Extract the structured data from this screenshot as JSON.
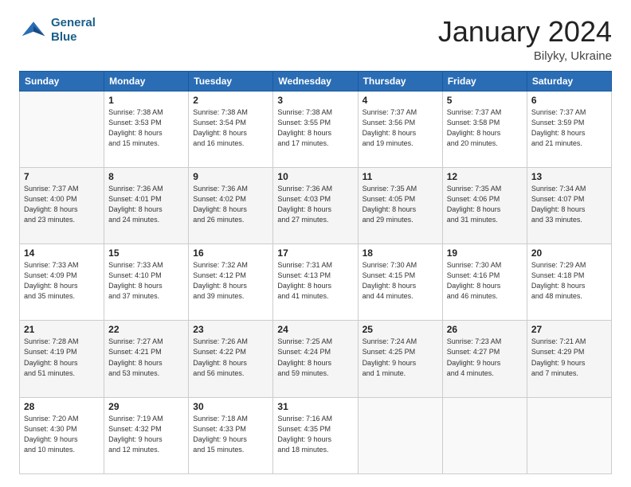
{
  "header": {
    "logo_line1": "General",
    "logo_line2": "Blue",
    "month": "January 2024",
    "location": "Bilyky, Ukraine"
  },
  "days_of_week": [
    "Sunday",
    "Monday",
    "Tuesday",
    "Wednesday",
    "Thursday",
    "Friday",
    "Saturday"
  ],
  "weeks": [
    [
      {
        "day": "",
        "info": ""
      },
      {
        "day": "1",
        "info": "Sunrise: 7:38 AM\nSunset: 3:53 PM\nDaylight: 8 hours\nand 15 minutes."
      },
      {
        "day": "2",
        "info": "Sunrise: 7:38 AM\nSunset: 3:54 PM\nDaylight: 8 hours\nand 16 minutes."
      },
      {
        "day": "3",
        "info": "Sunrise: 7:38 AM\nSunset: 3:55 PM\nDaylight: 8 hours\nand 17 minutes."
      },
      {
        "day": "4",
        "info": "Sunrise: 7:37 AM\nSunset: 3:56 PM\nDaylight: 8 hours\nand 19 minutes."
      },
      {
        "day": "5",
        "info": "Sunrise: 7:37 AM\nSunset: 3:58 PM\nDaylight: 8 hours\nand 20 minutes."
      },
      {
        "day": "6",
        "info": "Sunrise: 7:37 AM\nSunset: 3:59 PM\nDaylight: 8 hours\nand 21 minutes."
      }
    ],
    [
      {
        "day": "7",
        "info": "Sunrise: 7:37 AM\nSunset: 4:00 PM\nDaylight: 8 hours\nand 23 minutes."
      },
      {
        "day": "8",
        "info": "Sunrise: 7:36 AM\nSunset: 4:01 PM\nDaylight: 8 hours\nand 24 minutes."
      },
      {
        "day": "9",
        "info": "Sunrise: 7:36 AM\nSunset: 4:02 PM\nDaylight: 8 hours\nand 26 minutes."
      },
      {
        "day": "10",
        "info": "Sunrise: 7:36 AM\nSunset: 4:03 PM\nDaylight: 8 hours\nand 27 minutes."
      },
      {
        "day": "11",
        "info": "Sunrise: 7:35 AM\nSunset: 4:05 PM\nDaylight: 8 hours\nand 29 minutes."
      },
      {
        "day": "12",
        "info": "Sunrise: 7:35 AM\nSunset: 4:06 PM\nDaylight: 8 hours\nand 31 minutes."
      },
      {
        "day": "13",
        "info": "Sunrise: 7:34 AM\nSunset: 4:07 PM\nDaylight: 8 hours\nand 33 minutes."
      }
    ],
    [
      {
        "day": "14",
        "info": "Sunrise: 7:33 AM\nSunset: 4:09 PM\nDaylight: 8 hours\nand 35 minutes."
      },
      {
        "day": "15",
        "info": "Sunrise: 7:33 AM\nSunset: 4:10 PM\nDaylight: 8 hours\nand 37 minutes."
      },
      {
        "day": "16",
        "info": "Sunrise: 7:32 AM\nSunset: 4:12 PM\nDaylight: 8 hours\nand 39 minutes."
      },
      {
        "day": "17",
        "info": "Sunrise: 7:31 AM\nSunset: 4:13 PM\nDaylight: 8 hours\nand 41 minutes."
      },
      {
        "day": "18",
        "info": "Sunrise: 7:30 AM\nSunset: 4:15 PM\nDaylight: 8 hours\nand 44 minutes."
      },
      {
        "day": "19",
        "info": "Sunrise: 7:30 AM\nSunset: 4:16 PM\nDaylight: 8 hours\nand 46 minutes."
      },
      {
        "day": "20",
        "info": "Sunrise: 7:29 AM\nSunset: 4:18 PM\nDaylight: 8 hours\nand 48 minutes."
      }
    ],
    [
      {
        "day": "21",
        "info": "Sunrise: 7:28 AM\nSunset: 4:19 PM\nDaylight: 8 hours\nand 51 minutes."
      },
      {
        "day": "22",
        "info": "Sunrise: 7:27 AM\nSunset: 4:21 PM\nDaylight: 8 hours\nand 53 minutes."
      },
      {
        "day": "23",
        "info": "Sunrise: 7:26 AM\nSunset: 4:22 PM\nDaylight: 8 hours\nand 56 minutes."
      },
      {
        "day": "24",
        "info": "Sunrise: 7:25 AM\nSunset: 4:24 PM\nDaylight: 8 hours\nand 59 minutes."
      },
      {
        "day": "25",
        "info": "Sunrise: 7:24 AM\nSunset: 4:25 PM\nDaylight: 9 hours\nand 1 minute."
      },
      {
        "day": "26",
        "info": "Sunrise: 7:23 AM\nSunset: 4:27 PM\nDaylight: 9 hours\nand 4 minutes."
      },
      {
        "day": "27",
        "info": "Sunrise: 7:21 AM\nSunset: 4:29 PM\nDaylight: 9 hours\nand 7 minutes."
      }
    ],
    [
      {
        "day": "28",
        "info": "Sunrise: 7:20 AM\nSunset: 4:30 PM\nDaylight: 9 hours\nand 10 minutes."
      },
      {
        "day": "29",
        "info": "Sunrise: 7:19 AM\nSunset: 4:32 PM\nDaylight: 9 hours\nand 12 minutes."
      },
      {
        "day": "30",
        "info": "Sunrise: 7:18 AM\nSunset: 4:33 PM\nDaylight: 9 hours\nand 15 minutes."
      },
      {
        "day": "31",
        "info": "Sunrise: 7:16 AM\nSunset: 4:35 PM\nDaylight: 9 hours\nand 18 minutes."
      },
      {
        "day": "",
        "info": ""
      },
      {
        "day": "",
        "info": ""
      },
      {
        "day": "",
        "info": ""
      }
    ]
  ]
}
